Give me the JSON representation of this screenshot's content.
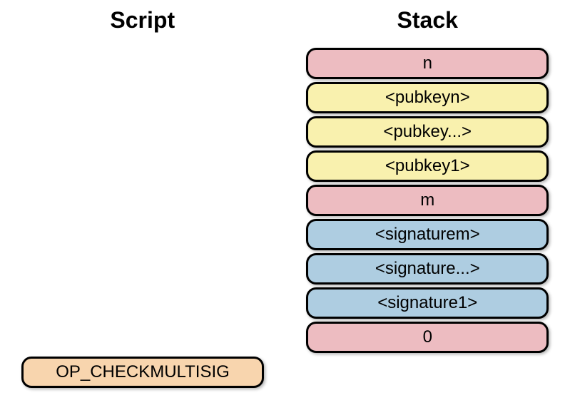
{
  "headers": {
    "script": "Script",
    "stack": "Stack"
  },
  "script_items": [
    {
      "label": "OP_CHECKMULTISIG",
      "color": "orange"
    }
  ],
  "stack_items": [
    {
      "label": "n",
      "color": "pink"
    },
    {
      "label": "<pubkeyn>",
      "color": "yellow"
    },
    {
      "label": "<pubkey...>",
      "color": "yellow"
    },
    {
      "label": "<pubkey1>",
      "color": "yellow"
    },
    {
      "label": "m",
      "color": "pink"
    },
    {
      "label": "<signaturem>",
      "color": "blue"
    },
    {
      "label": "<signature...>",
      "color": "blue"
    },
    {
      "label": "<signature1>",
      "color": "blue"
    },
    {
      "label": "0",
      "color": "pink"
    }
  ]
}
